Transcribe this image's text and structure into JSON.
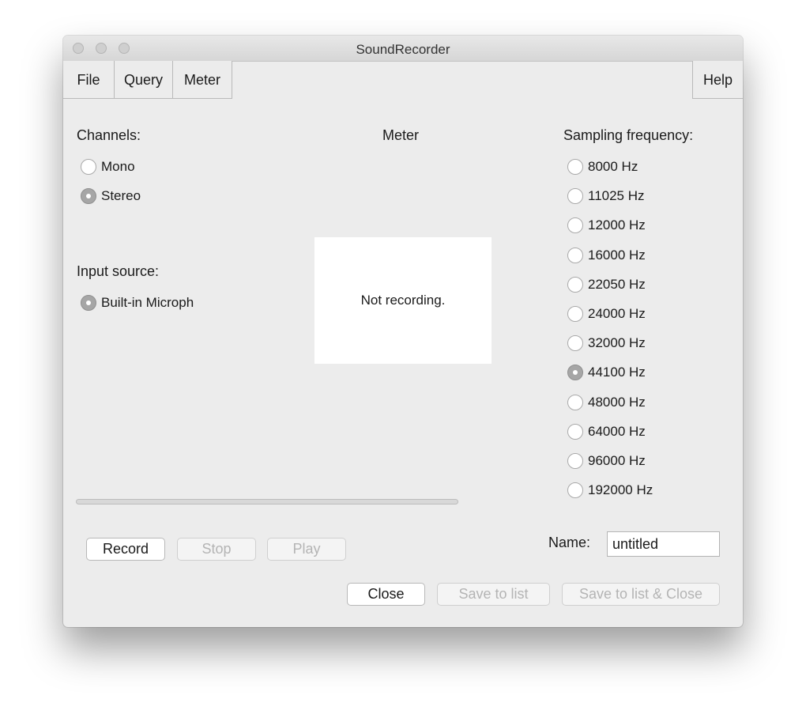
{
  "window": {
    "title": "SoundRecorder"
  },
  "menu": {
    "file": "File",
    "query": "Query",
    "meter": "Meter",
    "help": "Help"
  },
  "channels": {
    "label": "Channels:",
    "options": [
      {
        "label": "Mono",
        "checked": false
      },
      {
        "label": "Stereo",
        "checked": true
      }
    ]
  },
  "input_source": {
    "label": "Input source:",
    "options": [
      {
        "label": "Built-in Microph",
        "checked": true
      }
    ]
  },
  "meter": {
    "title": "Meter",
    "status": "Not recording."
  },
  "sampling": {
    "label": "Sampling frequency:",
    "options": [
      {
        "label": "8000 Hz",
        "checked": false
      },
      {
        "label": "11025 Hz",
        "checked": false
      },
      {
        "label": "12000 Hz",
        "checked": false
      },
      {
        "label": "16000 Hz",
        "checked": false
      },
      {
        "label": "22050 Hz",
        "checked": false
      },
      {
        "label": "24000 Hz",
        "checked": false
      },
      {
        "label": "32000 Hz",
        "checked": false
      },
      {
        "label": "44100 Hz",
        "checked": true
      },
      {
        "label": "48000 Hz",
        "checked": false
      },
      {
        "label": "64000 Hz",
        "checked": false
      },
      {
        "label": "96000 Hz",
        "checked": false
      },
      {
        "label": "192000 Hz",
        "checked": false
      }
    ]
  },
  "progress": {
    "value": 0
  },
  "buttons": {
    "record": "Record",
    "stop": "Stop",
    "play": "Play",
    "close": "Close",
    "save_to_list": "Save to list",
    "save_to_list_close": "Save to list & Close"
  },
  "name": {
    "label": "Name:",
    "value": "untitled"
  }
}
